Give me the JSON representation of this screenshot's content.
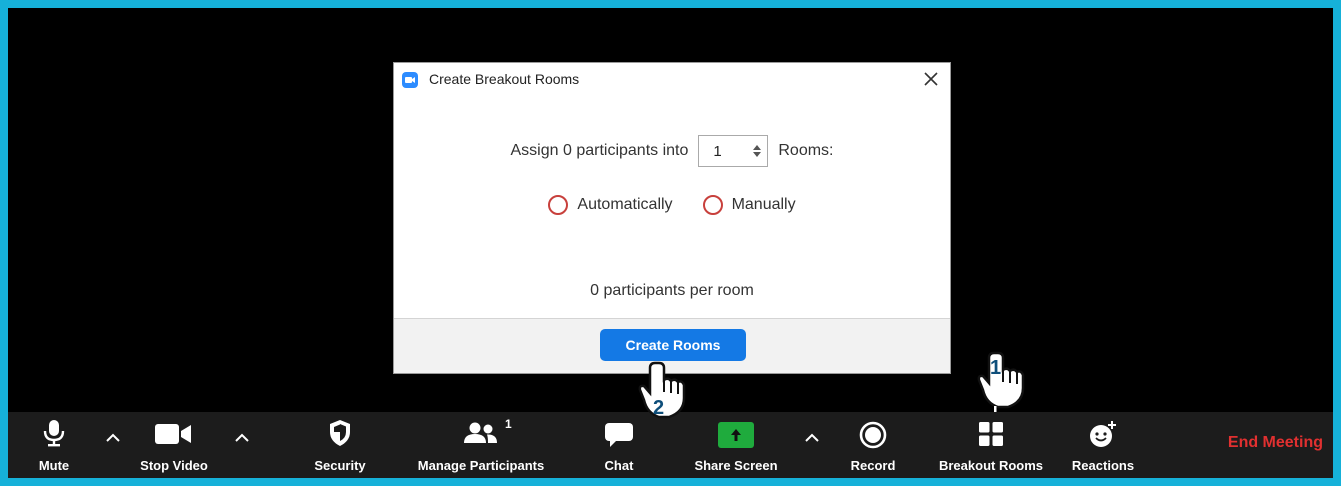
{
  "dialog": {
    "title": "Create Breakout Rooms",
    "assign_prefix": "Assign 0 participants into",
    "rooms_value": "1",
    "assign_suffix": "Rooms:",
    "options": [
      "Automatically",
      "Manually"
    ],
    "per_room_text": "0 participants per room",
    "create_button": "Create Rooms"
  },
  "toolbar": {
    "items": [
      {
        "label": "Mute",
        "icon": "microphone-icon"
      },
      {
        "label": "Stop Video",
        "icon": "video-camera-icon"
      },
      {
        "label": "Security",
        "icon": "shield-icon"
      },
      {
        "label": "Manage Participants",
        "icon": "participants-icon",
        "badge": "1"
      },
      {
        "label": "Chat",
        "icon": "chat-bubble-icon"
      },
      {
        "label": "Share Screen",
        "icon": "share-screen-icon"
      },
      {
        "label": "Record",
        "icon": "record-icon"
      },
      {
        "label": "Breakout Rooms",
        "icon": "breakout-rooms-icon"
      },
      {
        "label": "Reactions",
        "icon": "reactions-icon"
      }
    ],
    "end_meeting": "End Meeting"
  },
  "annotations": {
    "step1": "1",
    "step2": "2"
  },
  "colors": {
    "border": "#16b1d9",
    "accent": "#1479e5",
    "end_meeting": "#e13030",
    "share_green": "#1fab3d",
    "radio_red": "#c8403c"
  }
}
